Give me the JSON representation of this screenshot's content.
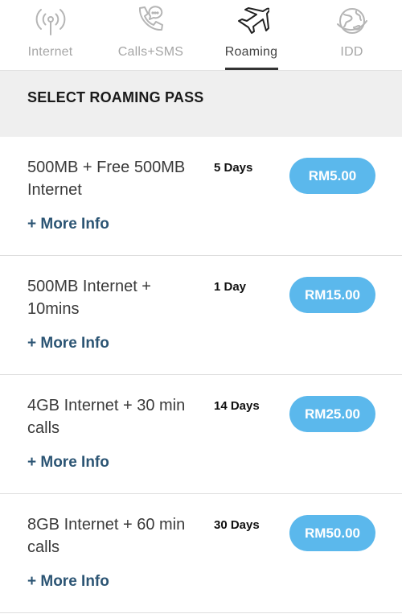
{
  "tabs": [
    {
      "label": "Internet",
      "icon": "signal-tower-icon",
      "active": false
    },
    {
      "label": "Calls+SMS",
      "icon": "phone-chat-icon",
      "active": false
    },
    {
      "label": "Roaming",
      "icon": "airplane-icon",
      "active": true
    },
    {
      "label": "IDD",
      "icon": "globe-phone-icon",
      "active": false
    }
  ],
  "section": {
    "title": "SELECT ROAMING PASS"
  },
  "passes": [
    {
      "name": "500MB + Free 500MB Internet",
      "duration": "5 Days",
      "price": "RM5.00",
      "more_info": "+ More Info"
    },
    {
      "name": "500MB Internet + 10mins",
      "duration": "1 Day",
      "price": "RM15.00",
      "more_info": "+ More Info"
    },
    {
      "name": "4GB Internet + 30 min calls",
      "duration": "14 Days",
      "price": "RM25.00",
      "more_info": "+ More Info"
    },
    {
      "name": "8GB Internet + 60 min calls",
      "duration": "30 Days",
      "price": "RM50.00",
      "more_info": "+ More Info"
    }
  ],
  "colors": {
    "accent_button": "#5bb8ec",
    "link": "#2c5574",
    "section_bg": "#efefef",
    "inactive_tab": "#a6a6a6"
  }
}
